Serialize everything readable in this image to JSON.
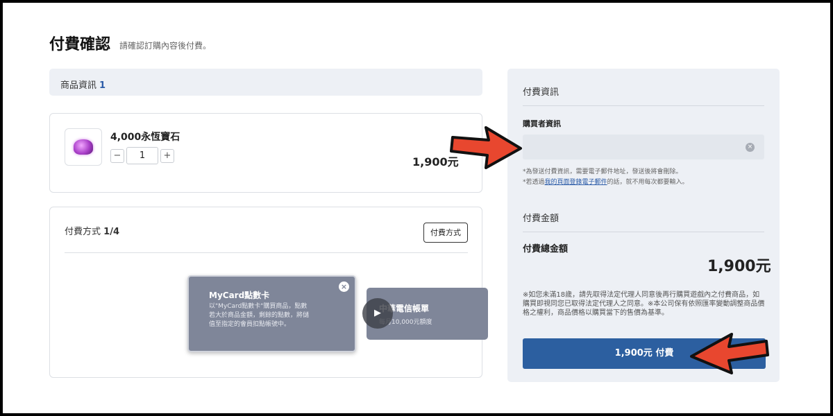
{
  "page": {
    "title": "付費確認",
    "subtitle": "請確認訂購內容後付費。"
  },
  "product_section": {
    "label": "商品資訊",
    "count": "1",
    "item": {
      "name": "4,000永恆寶石",
      "quantity": "1",
      "minus": "−",
      "plus": "+",
      "price": "1,900元",
      "icon": "gem-icon"
    }
  },
  "payment_section": {
    "label": "付費方式",
    "count": "1/4",
    "button_label": "付費方式",
    "options": [
      {
        "title": "MyCard點數卡",
        "desc": "以\"MyCard點數卡\"購買商品，點數若大於商品金額，剩餘的點數，將儲值至指定的會員扣點帳號中。",
        "close": "×"
      },
      {
        "title": "中華電信帳單",
        "desc": "每月10,000元額度"
      }
    ],
    "next_icon": "▶"
  },
  "side": {
    "title": "付費資訊",
    "buyer_label": "購買者資訊",
    "email_value": "",
    "clear_icon": "×",
    "note1": "*為發送付費資訊，需要電子郵件地址，發送後將會刪除。",
    "note2_prefix": "*若透過",
    "note2_link": "我的頁面登錄電子郵件",
    "note2_suffix": "的話，就不用每次都要輸入。",
    "amount_title": "付費金額",
    "total_label": "付費總金額",
    "total_value": "1,900元",
    "legal": "※如您未滿18歲，請先取得法定代理人同意後再行購買遊戲內之付費商品，如購買即視同您已取得法定代理人之同意。※本公司保有依照匯率變動調整商品價格之權利，商品價格以購買當下的售價為基準。",
    "pay_button": "1,900元 付費"
  },
  "colors": {
    "accent": "#2c5fa0",
    "annotation_arrow": "#e8472f"
  }
}
